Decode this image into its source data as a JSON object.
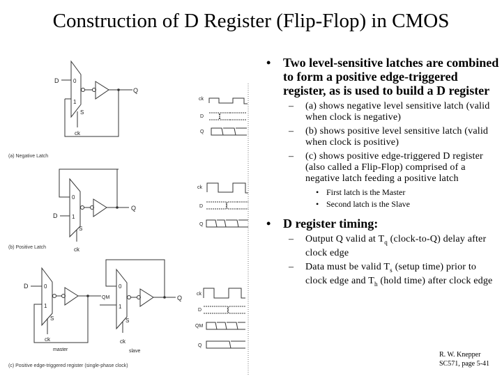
{
  "slide": {
    "title": "Construction of D Register (Flip-Flop) in CMOS"
  },
  "figure": {
    "panels": [
      {
        "caption": "(a)  Negative Latch",
        "mux_inputs": [
          "0",
          "1"
        ],
        "mux_select": "S",
        "labels": {
          "input": "D",
          "output": "Q",
          "clock": "ck"
        },
        "waveform_labels": [
          "ck",
          "D",
          "Q"
        ]
      },
      {
        "caption": "(b)  Positive Latch",
        "mux_inputs": [
          "0",
          "1"
        ],
        "mux_select": "S",
        "labels": {
          "input": "D",
          "output": "Q",
          "clock": "ck"
        },
        "waveform_labels": [
          "ck",
          "D",
          "Q"
        ]
      },
      {
        "caption": "(c)  Positive edge-triggered  register (single-phase clock)",
        "mux_inputs": [
          "0",
          "1"
        ],
        "mux_select": "S",
        "labels": {
          "input": "D",
          "output": "Q",
          "internal": "QM",
          "clock": "ck",
          "master": "master",
          "slave": "slave"
        },
        "waveform_labels": [
          "ck",
          "D",
          "QM",
          "Q"
        ]
      }
    ]
  },
  "bullets": [
    {
      "text": "Two level-sensitive latches are combined to form a positive edge-triggered register, as is used to build a D register",
      "marker": "•",
      "sub": [
        {
          "marker": "–",
          "text": "(a) shows negative level sensitive latch (valid when clock is negative)"
        },
        {
          "marker": "–",
          "text": "(b) shows positive level sensitive latch (valid when clock is positive)"
        },
        {
          "marker": "–",
          "text": "(c) shows positive edge-triggered D register (also called a Flip-Flop) comprised of a negative latch feeding a positive latch",
          "sub": [
            {
              "marker": "•",
              "text": "First latch is the Master"
            },
            {
              "marker": "•",
              "text": "Second latch is the Slave"
            }
          ]
        }
      ]
    },
    {
      "text": "D register timing:",
      "marker": "•",
      "sub": [
        {
          "marker": "–",
          "pre": "Output Q valid at T",
          "subscript": "q",
          "post": " (clock-to-Q) delay after clock edge"
        },
        {
          "marker": "–",
          "pre": "Data must be valid T",
          "subscript": "s",
          "mid": " (setup time) prior to clock edge and T",
          "subscript2": "h",
          "post": " (hold time) after clock edge"
        }
      ]
    }
  ],
  "footer": {
    "author": "R. W. Knepper",
    "course_page": "SC571, page 5-41"
  }
}
